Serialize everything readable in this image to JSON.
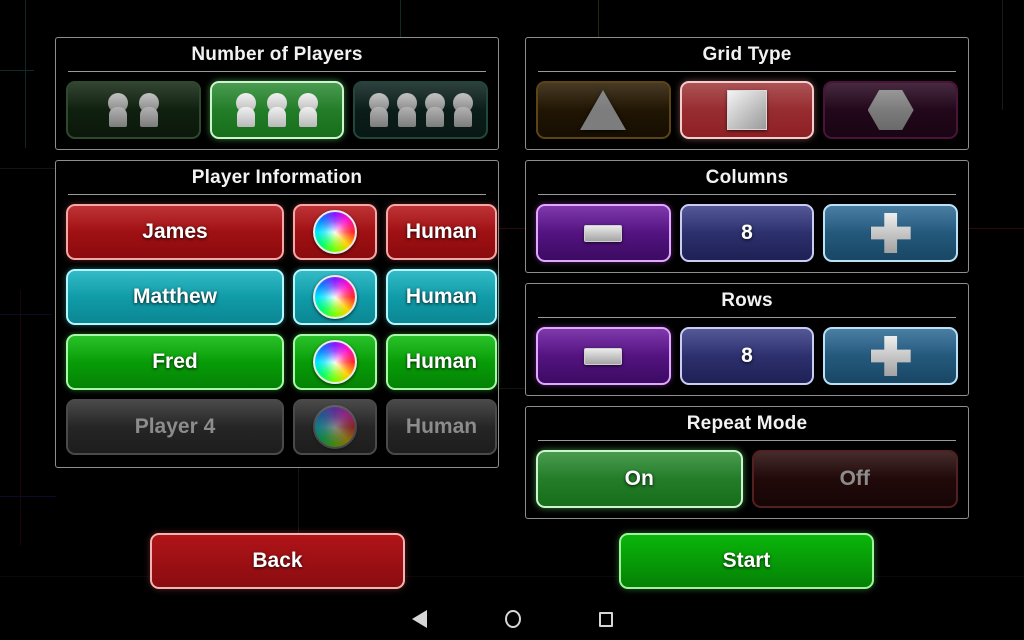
{
  "background": {
    "color": "#000000",
    "trace_colors": [
      "#0d2a27",
      "#2a2608",
      "#1a0606",
      "#0b0b28"
    ]
  },
  "panels": {
    "number_of_players": {
      "title": "Number of Players",
      "options": [
        {
          "label": "2 players",
          "icon": "two-people-icon",
          "count": 2,
          "selected": false
        },
        {
          "label": "3 players",
          "icon": "three-people-icon",
          "count": 3,
          "selected": true
        },
        {
          "label": "4 players",
          "icon": "four-people-icon",
          "count": 4,
          "selected": false
        }
      ]
    },
    "grid_type": {
      "title": "Grid Type",
      "options": [
        {
          "label": "Triangle",
          "icon": "triangle-icon",
          "selected": false
        },
        {
          "label": "Square",
          "icon": "square-icon",
          "selected": true
        },
        {
          "label": "Hexagon",
          "icon": "hexagon-icon",
          "selected": false
        }
      ]
    },
    "player_information": {
      "title": "Player Information",
      "players": [
        {
          "name": "James",
          "color": "#b41518",
          "type": "Human",
          "color_icon": "color-wheel-icon",
          "enabled": true
        },
        {
          "name": "Matthew",
          "color": "#15b0bd",
          "type": "Human",
          "color_icon": "color-wheel-icon",
          "enabled": true
        },
        {
          "name": "Fred",
          "color": "#0ab80a",
          "type": "Human",
          "color_icon": "color-wheel-icon",
          "enabled": true
        },
        {
          "name": "Player 4",
          "color": "#2e2e2e",
          "type": "Human",
          "color_icon": "color-wheel-icon",
          "enabled": false
        }
      ]
    },
    "columns": {
      "title": "Columns",
      "decrement_icon": "minus-icon",
      "value": "8",
      "increment_icon": "plus-icon"
    },
    "rows": {
      "title": "Rows",
      "decrement_icon": "minus-icon",
      "value": "8",
      "increment_icon": "plus-icon"
    },
    "repeat_mode": {
      "title": "Repeat Mode",
      "options": [
        {
          "label": "On",
          "selected": true
        },
        {
          "label": "Off",
          "selected": false
        }
      ]
    }
  },
  "actions": {
    "back_label": "Back",
    "start_label": "Start"
  },
  "navbar": {
    "back_icon": "nav-back-icon",
    "home_icon": "nav-home-icon",
    "recent_icon": "nav-recent-icon"
  }
}
